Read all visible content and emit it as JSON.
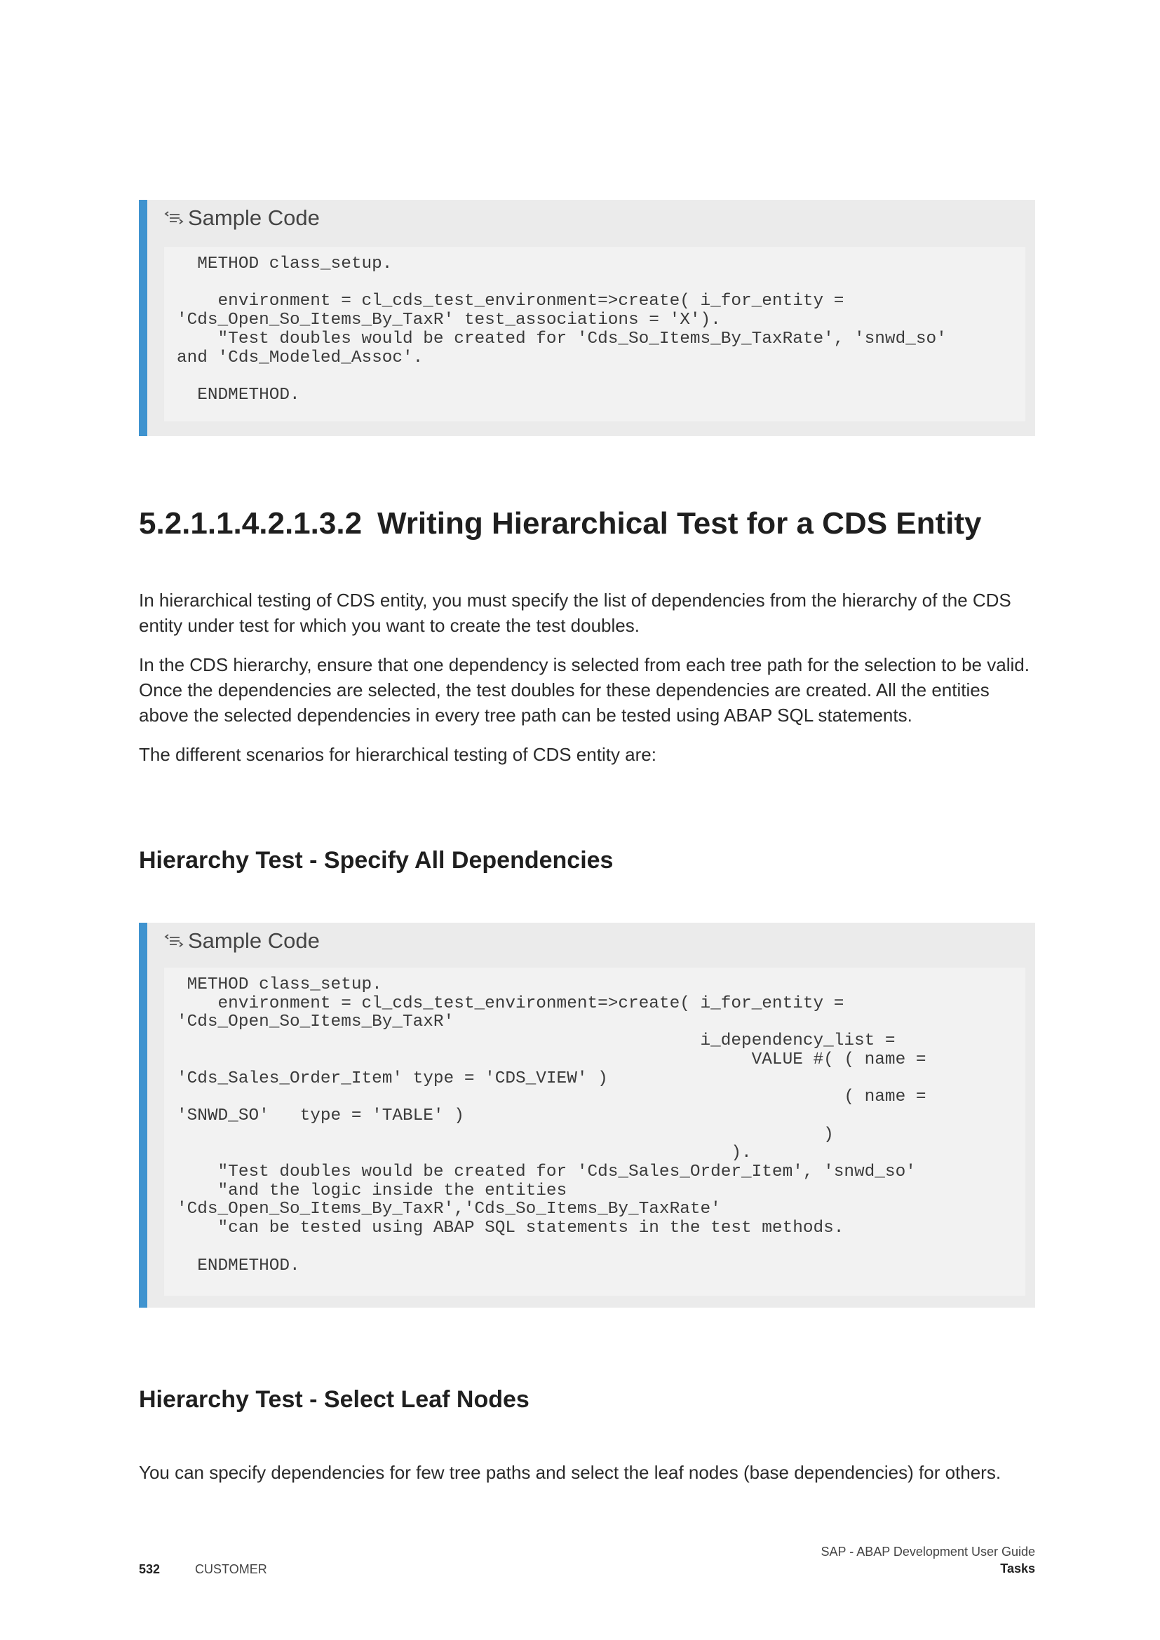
{
  "code_block_1": {
    "header": "Sample Code",
    "icon": "sample-code-icon",
    "code": "  METHOD class_setup.\n\n    environment = cl_cds_test_environment=>create( i_for_entity = \n'Cds_Open_So_Items_By_TaxR' test_associations = 'X').\n    \"Test doubles would be created for 'Cds_So_Items_By_TaxRate', 'snwd_so' \nand 'Cds_Modeled_Assoc'.\n\n  ENDMETHOD."
  },
  "section": {
    "number": "5.2.1.1.4.2.1.3.2",
    "title": "Writing Hierarchical Test for a CDS Entity"
  },
  "paragraphs": [
    "In hierarchical testing of CDS entity, you must specify the list of dependencies from the hierarchy of the CDS entity under test for which you want to create the test doubles.",
    "In the CDS hierarchy, ensure that one dependency is selected from each tree path for the selection to be valid. Once the dependencies are selected, the test doubles for these dependencies are created. All the entities above the selected dependencies in every tree path can be tested using ABAP SQL statements.",
    "The different scenarios for hierarchical testing of CDS entity are:"
  ],
  "subheading_1": "Hierarchy Test - Specify All Dependencies",
  "code_block_2": {
    "header": "Sample Code",
    "icon": "sample-code-icon",
    "code": " METHOD class_setup.\n    environment = cl_cds_test_environment=>create( i_for_entity = \n'Cds_Open_So_Items_By_TaxR'\n                                                   i_dependency_list = \n                                                        VALUE #( ( name = \n'Cds_Sales_Order_Item' type = 'CDS_VIEW' )\n                                                                 ( name = \n'SNWD_SO'   type = 'TABLE' )\n                                                               )\n                                                      ).\n    \"Test doubles would be created for 'Cds_Sales_Order_Item', 'snwd_so'\n    \"and the logic inside the entities \n'Cds_Open_So_Items_By_TaxR','Cds_So_Items_By_TaxRate'\n    \"can be tested using ABAP SQL statements in the test methods.\n\n  ENDMETHOD."
  },
  "subheading_2": "Hierarchy Test - Select Leaf Nodes",
  "paragraph_last": "You can specify dependencies for few tree paths and select the leaf nodes (base dependencies) for others.",
  "footer": {
    "page_number": "532",
    "classification": "CUSTOMER",
    "doc_title": "SAP - ABAP Development User Guide",
    "section_name": "Tasks"
  },
  "colors": {
    "accent_bar": "#3f93cf",
    "code_frame": "#ebebeb",
    "code_background": "#f2f2f2"
  }
}
